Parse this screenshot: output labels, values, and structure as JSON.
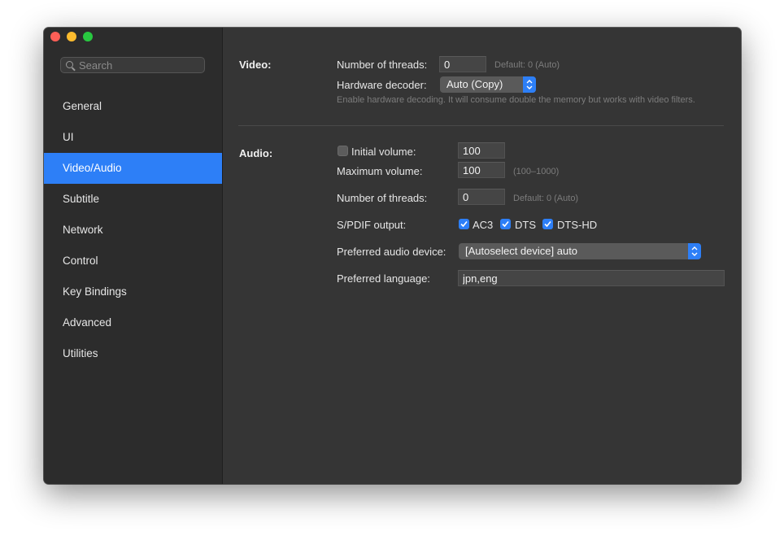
{
  "sidebar": {
    "search_placeholder": "Search",
    "items": [
      {
        "label": "General"
      },
      {
        "label": "UI"
      },
      {
        "label": "Video/Audio"
      },
      {
        "label": "Subtitle"
      },
      {
        "label": "Network"
      },
      {
        "label": "Control"
      },
      {
        "label": "Key Bindings"
      },
      {
        "label": "Advanced"
      },
      {
        "label": "Utilities"
      }
    ],
    "active_index": 2
  },
  "video": {
    "section_label": "Video:",
    "threads_label": "Number of threads:",
    "threads_value": "0",
    "threads_hint": "Default: 0 (Auto)",
    "decoder_label": "Hardware decoder:",
    "decoder_value": "Auto (Copy)",
    "decoder_hint": "Enable hardware decoding. It will consume double the memory but works with video filters."
  },
  "audio": {
    "section_label": "Audio:",
    "initial_volume_label": "Initial volume:",
    "initial_volume_checked": false,
    "initial_volume_value": "100",
    "max_volume_label": "Maximum volume:",
    "max_volume_value": "100",
    "max_volume_hint": "(100–1000)",
    "threads_label": "Number of threads:",
    "threads_value": "0",
    "threads_hint": "Default: 0 (Auto)",
    "spdif_label": "S/PDIF output:",
    "spdif_ac3": "AC3",
    "spdif_dts": "DTS",
    "spdif_dtshd": "DTS-HD",
    "device_label": "Preferred audio device:",
    "device_value": "[Autoselect device] auto",
    "language_label": "Preferred language:",
    "language_value": "jpn,eng"
  },
  "colors": {
    "accent": "#2d7ff7",
    "window_bg": "#353535",
    "sidebar_bg": "#2c2c2c"
  }
}
